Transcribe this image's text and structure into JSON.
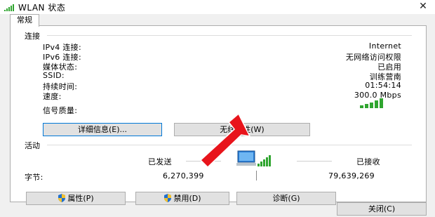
{
  "window": {
    "title": "WLAN 状态",
    "close_glyph": "✕"
  },
  "tabs": [
    {
      "label": "常规"
    }
  ],
  "connection": {
    "group_label": "连接",
    "rows": [
      {
        "label": "IPv4 连接:",
        "value": "Internet"
      },
      {
        "label": "IPv6 连接:",
        "value": "无网络访问权限"
      },
      {
        "label": "媒体状态:",
        "value": "已启用"
      },
      {
        "label": "SSID:",
        "value": "训练营南"
      },
      {
        "label": "持续时间:",
        "value": "01:54:14"
      },
      {
        "label": "速度:",
        "value": "300.0 Mbps"
      }
    ],
    "signal_label": "信号质量:",
    "signal_bars": 5,
    "details_button": "详细信息(E)...",
    "wireless_button": "无线属性(W)"
  },
  "activity": {
    "group_label": "活动",
    "sent_label": "已发送",
    "received_label": "已接收",
    "bytes_label": "字节:",
    "bytes_sent": "6,270,399",
    "bytes_received": "79,639,269"
  },
  "actions": {
    "properties_button": "属性(P)",
    "disable_button": "禁用(D)",
    "diagnose_button": "诊断(G)"
  },
  "footer": {
    "close_button": "关闭(C)"
  },
  "colors": {
    "accent": "#0078d7",
    "signal": "#2fa52f",
    "annotation_arrow": "#e8141b"
  }
}
